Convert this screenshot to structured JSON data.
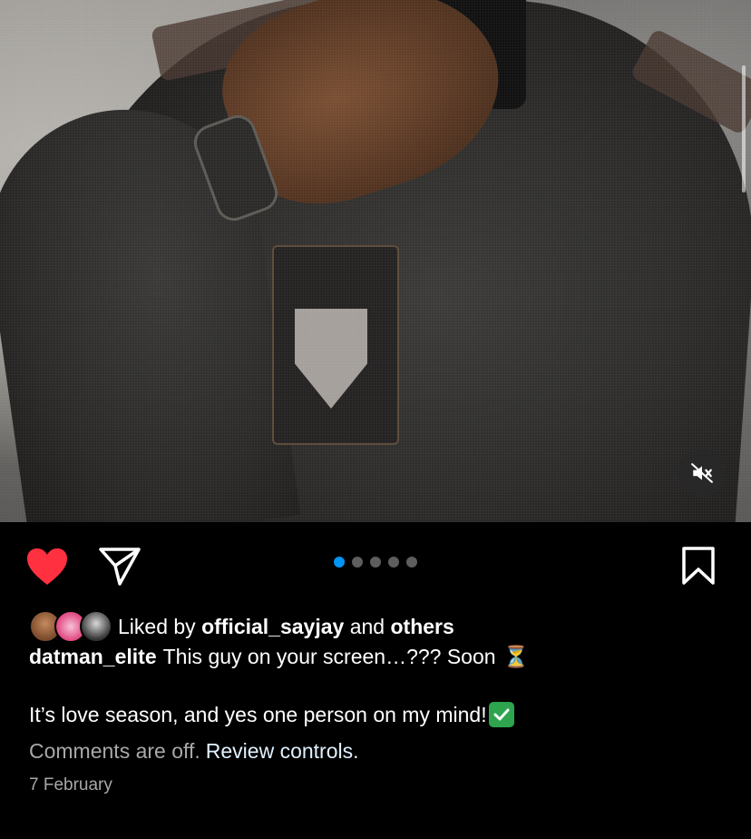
{
  "post": {
    "media": {
      "alt_icon": "mute-icon",
      "carousel_total": 5,
      "carousel_active_index": 0
    },
    "actions": {
      "like_icon": "heart-filled-icon",
      "like_color": "#ff3040",
      "share_icon": "send-icon",
      "save_icon": "bookmark-icon",
      "dot_active_color": "#0095f6"
    },
    "likes": {
      "prefix": "Liked by",
      "user": "official_sayjay",
      "joiner": "and",
      "others": "others"
    },
    "caption": {
      "username": "datman_elite",
      "text": "This guy on your screen…??? Soon",
      "emoji": "⏳",
      "line2": "It’s love season, and yes one person on my mind!",
      "line2_emoji": "✅"
    },
    "comments": {
      "off_text": "Comments are off.",
      "review_link": "Review controls."
    },
    "date": "7 February"
  }
}
